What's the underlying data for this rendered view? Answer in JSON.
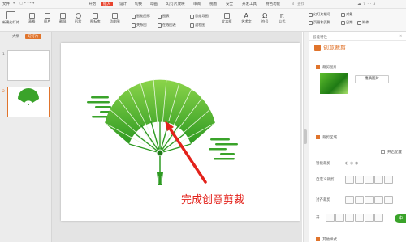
{
  "menu": {
    "file": "文件",
    "items": [
      "开始",
      "插入",
      "设计",
      "切换",
      "动画",
      "幻灯片放映",
      "审阅",
      "视图",
      "安全",
      "开发工具",
      "特色功能"
    ],
    "active_index": 1,
    "search_placeholder": "查找"
  },
  "ribbon": {
    "new_slide": "新建幻灯片",
    "table": "表格",
    "picture": "图片",
    "screenshot": "截屏",
    "shape": "形状",
    "icon_lib": "图标库",
    "func_chart": "功能图",
    "smart_graphic": "智能图形",
    "chart": "图表",
    "online_diagram": "在线图表",
    "relation": "关系图",
    "mind_map": "思维导图",
    "flowchart": "流程图",
    "textbox": "文本框",
    "art_text": "艺术字",
    "symbol": "符号",
    "formula": "公式",
    "slide_number": "幻灯片编号",
    "object": "对象",
    "header_footer": "页眉和页脚",
    "date": "日期",
    "attachment": "附件"
  },
  "left_panel": {
    "tab_outline": "大纲",
    "tab_slides": "幻灯片",
    "slide_numbers": [
      "1",
      "2"
    ]
  },
  "slide": {
    "annotation": "完成创意剪裁"
  },
  "right_panel": {
    "header": "智能特性",
    "title": "创意裁剪",
    "crop_image_label": "裁剪图片",
    "change_image_button": "更换图片",
    "crop_area_label": "裁剪区域",
    "open_mode_label": "开启配置",
    "smart_crop_label": "智能裁剪",
    "custom_crop_label": "自定义裁剪",
    "align_crop_label": "对齐裁剪",
    "more_styles_label": "其他样式",
    "start_label": "开",
    "zoom_fragment": "中"
  },
  "colors": {
    "accent": "#e0742c",
    "insert_tab": "#e8442e",
    "arrow": "#e3221b",
    "fan_green": "#3aa32a",
    "fan_light": "#8bd44a"
  }
}
